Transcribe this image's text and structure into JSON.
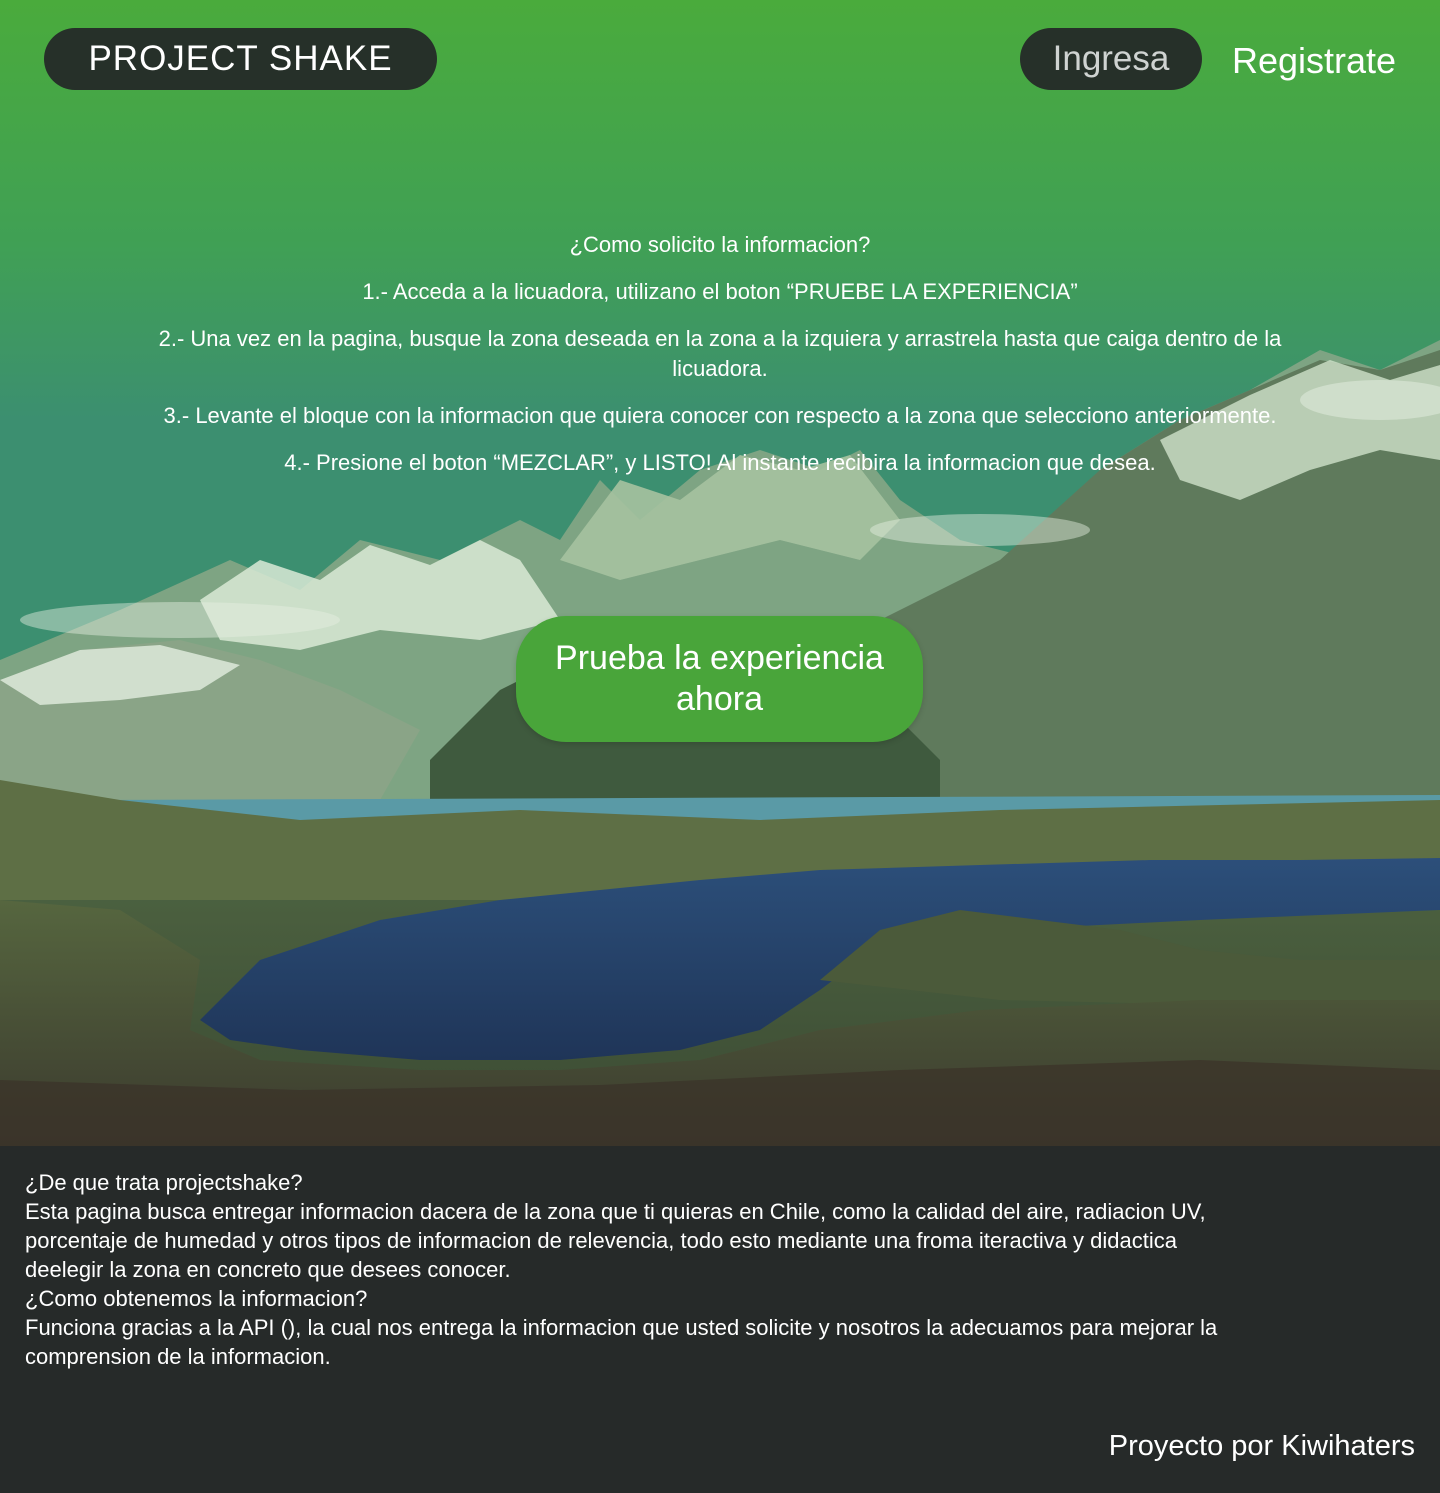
{
  "header": {
    "logo": "PROJECT SHAKE",
    "login_label": "Ingresa",
    "register_label": "Registrate"
  },
  "instructions": {
    "heading": "¿Como solicito la informacion?",
    "steps": [
      "1.- Acceda a la licuadora, utilizano el boton “PRUEBE LA EXPERIENCIA”",
      "2.- Una vez en la pagina, busque la zona deseada en la zona a la izquiera y arrastrela hasta que caiga dentro de la licuadora.",
      "3.- Levante el bloque con la informacion que quiera conocer con respecto a la zona que selecciono anteriormente.",
      "4.- Presione el boton “MEZCLAR”, y LISTO! Al instante recibira la informacion que desea."
    ]
  },
  "cta": {
    "label": "Prueba la experiencia ahora"
  },
  "about": {
    "q1": "¿De que trata projectshake?",
    "a1": "Esta pagina busca entregar informacion dacera de la zona que ti quieras en Chile, como la calidad del aire, radiacion UV, porcentaje de humedad y otros tipos de informacion de relevencia, todo esto mediante una froma iteractiva y didactica deelegir la zona en concreto que desees conocer.",
    "q2": "¿Como obtenemos la informacion?",
    "a2": "Funciona gracias a la API (), la cual nos entrega la informacion que usted solicite y nosotros la adecuamos para mejorar la comprension de la informacion."
  },
  "footer": {
    "credit": "Proyecto por Kiwihaters"
  },
  "colors": {
    "accent_green": "#49a53a",
    "dark_pill": "#263029",
    "footer_bg": "#262a29"
  }
}
